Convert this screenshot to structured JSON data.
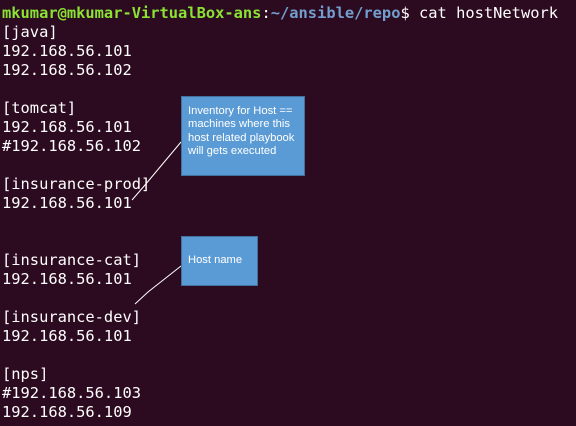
{
  "prompt": {
    "user_host": "mkumar@mkumar-VirtualBox-ans",
    "separator": ":",
    "path": "~/ansible/repo",
    "symbol": "$ ",
    "command": "cat hostNetwork"
  },
  "output_lines": [
    "[java]",
    "192.168.56.101",
    "192.168.56.102",
    "",
    "[tomcat]",
    "192.168.56.101",
    "#192.168.56.102",
    "",
    "[insurance-prod]",
    "192.168.56.101",
    "",
    "",
    "[insurance-cat]",
    "192.168.56.101",
    "",
    "[insurance-dev]",
    "192.168.56.101",
    "",
    "[nps]",
    "#192.168.56.103",
    "192.168.56.109"
  ],
  "callouts": {
    "inventory": "Inventory for Host == machines where this host related playbook will gets executed",
    "host_name": "Host name"
  },
  "colors": {
    "background": "#2c0a1f",
    "prompt_user": "#8ae234",
    "prompt_path": "#729fcf",
    "text": "#ffffff",
    "callout_fill": "#5b9bd5",
    "callout_border": "#41719c"
  }
}
